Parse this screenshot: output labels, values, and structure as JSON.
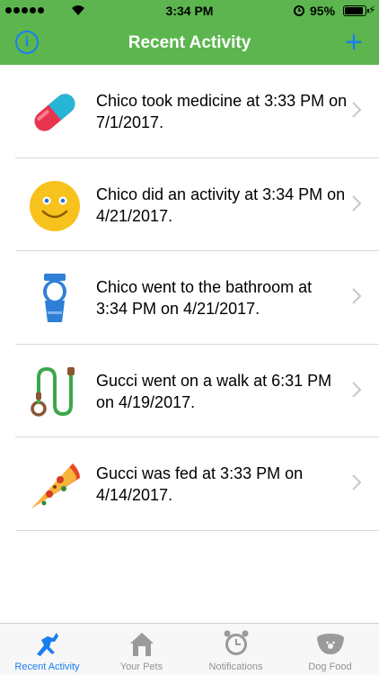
{
  "status_bar": {
    "time": "3:34 PM",
    "battery": "95%",
    "icons": [
      "signal-dots-icon",
      "wifi-icon",
      "alarm-clock-icon",
      "battery-icon",
      "charging-bolt-icon"
    ]
  },
  "nav": {
    "title": "Recent Activity",
    "info_icon": "info-circle-icon",
    "add_icon": "plus-icon",
    "accent": "#1a7ef0",
    "bar_color": "#5cb54e"
  },
  "activities": [
    {
      "icon": "pill-icon",
      "text": "Chico took medicine at 3:33 PM on 7/1/2017."
    },
    {
      "icon": "smiley-face-icon",
      "text": "Chico did an activity at 3:34 PM on 4/21/2017."
    },
    {
      "icon": "toilet-icon",
      "text": "Chico went to the bathroom at 3:34 PM on 4/21/2017."
    },
    {
      "icon": "leash-icon",
      "text": "Gucci went on a walk at 6:31 PM on 4/19/2017."
    },
    {
      "icon": "pizza-slice-icon",
      "text": "Gucci was fed at 3:33 PM on 4/14/2017."
    }
  ],
  "tabs": [
    {
      "label": "Recent Activity",
      "icon": "running-dog-icon",
      "active": true
    },
    {
      "label": "Your Pets",
      "icon": "house-icon",
      "active": false
    },
    {
      "label": "Notifications",
      "icon": "alarm-clock-icon",
      "active": false
    },
    {
      "label": "Dog Food",
      "icon": "dog-bowl-icon",
      "active": false
    }
  ]
}
